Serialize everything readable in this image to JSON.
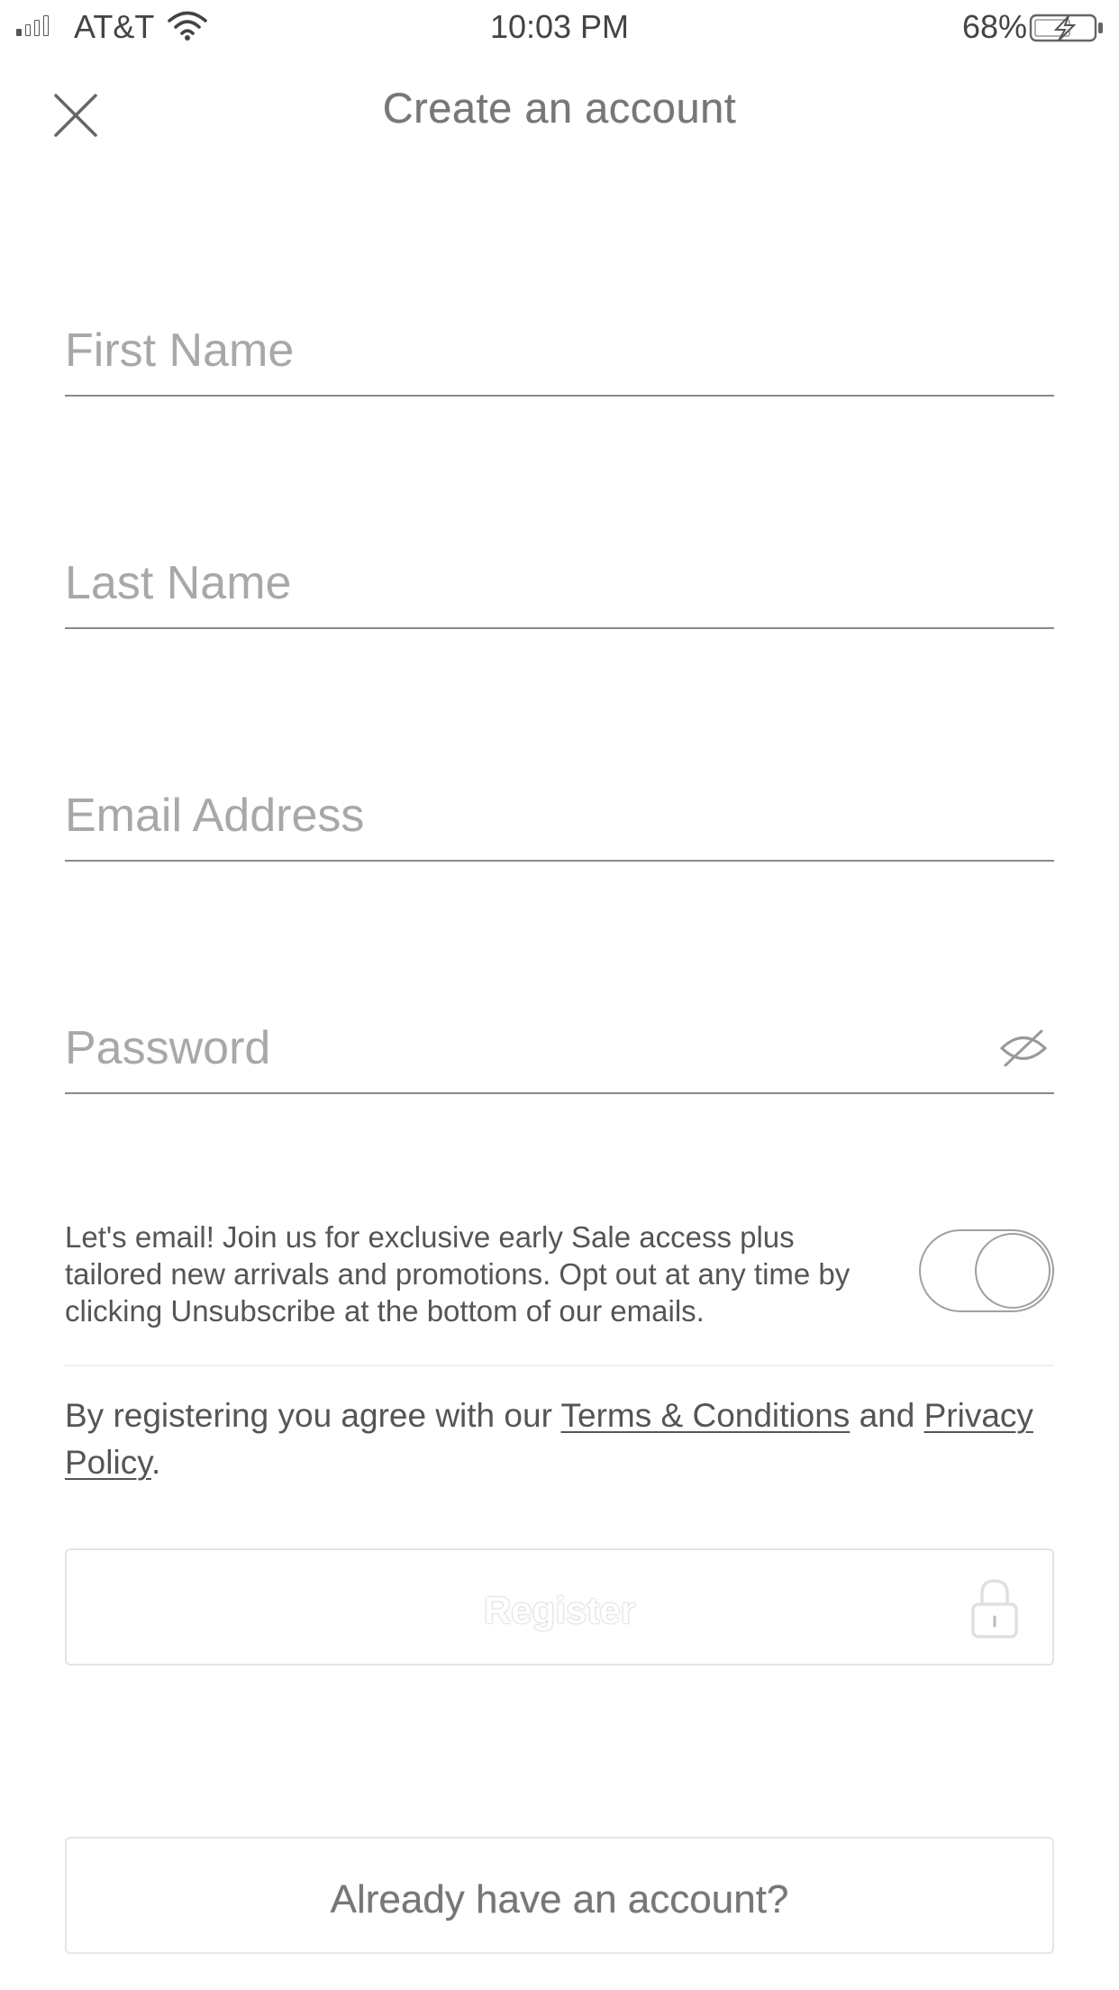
{
  "status_bar": {
    "carrier": "AT&T",
    "time": "10:03 PM",
    "battery_percent": "68%",
    "signal_bars_filled": 1,
    "signal_bars_total": 4,
    "icons": [
      "signal-icon",
      "wifi-icon",
      "battery-charging-icon"
    ]
  },
  "header": {
    "title": "Create an account",
    "close_icon": "close-icon"
  },
  "form": {
    "first_name": {
      "placeholder": "First Name",
      "value": ""
    },
    "last_name": {
      "placeholder": "Last Name",
      "value": ""
    },
    "email": {
      "placeholder": "Email Address",
      "value": ""
    },
    "password": {
      "placeholder": "Password",
      "value": "",
      "toggle_icon": "eye-slash-icon"
    }
  },
  "optin": {
    "text": "Let's email! Join us for exclusive early Sale access plus tailored new arrivals and promotions. Opt out at any time by clicking Unsubscribe at the bottom of our emails.",
    "enabled": false
  },
  "legal": {
    "prefix": "By registering you agree with our ",
    "terms_label": "Terms & Conditions",
    "middle": " and ",
    "privacy_label": "Privacy Policy",
    "suffix": "."
  },
  "actions": {
    "register_label": "Register",
    "register_icon": "lock-icon",
    "signin_label": "Already have an account?"
  },
  "colors": {
    "text": "#555555",
    "placeholder": "#a8a8a8",
    "underline": "#8a8a8a",
    "button_border": "#e4e4e4"
  }
}
